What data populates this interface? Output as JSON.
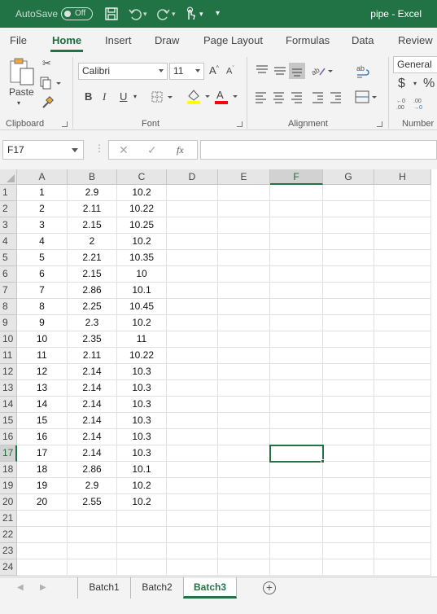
{
  "titlebar": {
    "autosave_label": "AutoSave",
    "autosave_state": "Off",
    "title": "pipe  -  Excel"
  },
  "ribbon_tabs": [
    "File",
    "Home",
    "Insert",
    "Draw",
    "Page Layout",
    "Formulas",
    "Data",
    "Review"
  ],
  "active_tab": "Home",
  "ribbon": {
    "clipboard": {
      "paste_label": "Paste",
      "group_label": "Clipboard"
    },
    "font": {
      "font_name": "Calibri",
      "font_size": "11",
      "bold": "B",
      "italic": "I",
      "underline": "U",
      "group_label": "Font"
    },
    "alignment": {
      "group_label": "Alignment"
    },
    "number": {
      "format": "General",
      "currency": "$",
      "percent": "%",
      "group_label": "Number"
    }
  },
  "formula_bar": {
    "name_box": "F17",
    "fx": "fx",
    "formula": ""
  },
  "grid": {
    "columns": [
      "A",
      "B",
      "C",
      "D",
      "E",
      "F",
      "G",
      "H"
    ],
    "selected_column": "F",
    "selected_row": 17,
    "rows": [
      {
        "n": "1",
        "a": "1",
        "b": "2.9",
        "c": "10.2"
      },
      {
        "n": "2",
        "a": "2",
        "b": "2.11",
        "c": "10.22"
      },
      {
        "n": "3",
        "a": "3",
        "b": "2.15",
        "c": "10.25"
      },
      {
        "n": "4",
        "a": "4",
        "b": "2",
        "c": "10.2"
      },
      {
        "n": "5",
        "a": "5",
        "b": "2.21",
        "c": "10.35"
      },
      {
        "n": "6",
        "a": "6",
        "b": "2.15",
        "c": "10"
      },
      {
        "n": "7",
        "a": "7",
        "b": "2.86",
        "c": "10.1"
      },
      {
        "n": "8",
        "a": "8",
        "b": "2.25",
        "c": "10.45"
      },
      {
        "n": "9",
        "a": "9",
        "b": "2.3",
        "c": "10.2"
      },
      {
        "n": "10",
        "a": "10",
        "b": "2.35",
        "c": "11"
      },
      {
        "n": "11",
        "a": "11",
        "b": "2.11",
        "c": "10.22"
      },
      {
        "n": "12",
        "a": "12",
        "b": "2.14",
        "c": "10.3"
      },
      {
        "n": "13",
        "a": "13",
        "b": "2.14",
        "c": "10.3"
      },
      {
        "n": "14",
        "a": "14",
        "b": "2.14",
        "c": "10.3"
      },
      {
        "n": "15",
        "a": "15",
        "b": "2.14",
        "c": "10.3"
      },
      {
        "n": "16",
        "a": "16",
        "b": "2.14",
        "c": "10.3"
      },
      {
        "n": "17",
        "a": "17",
        "b": "2.14",
        "c": "10.3"
      },
      {
        "n": "18",
        "a": "18",
        "b": "2.86",
        "c": "10.1"
      },
      {
        "n": "19",
        "a": "19",
        "b": "2.9",
        "c": "10.2"
      },
      {
        "n": "20",
        "a": "20",
        "b": "2.55",
        "c": "10.2"
      },
      {
        "n": "21",
        "a": "",
        "b": "",
        "c": ""
      },
      {
        "n": "22",
        "a": "",
        "b": "",
        "c": ""
      },
      {
        "n": "23",
        "a": "",
        "b": "",
        "c": ""
      },
      {
        "n": "24",
        "a": "",
        "b": "",
        "c": ""
      }
    ]
  },
  "sheets": [
    "Batch1",
    "Batch2",
    "Batch3"
  ],
  "active_sheet": "Batch3",
  "colors": {
    "accent": "#217346",
    "highlight": "#ffff00",
    "font_color": "#ff0000"
  }
}
